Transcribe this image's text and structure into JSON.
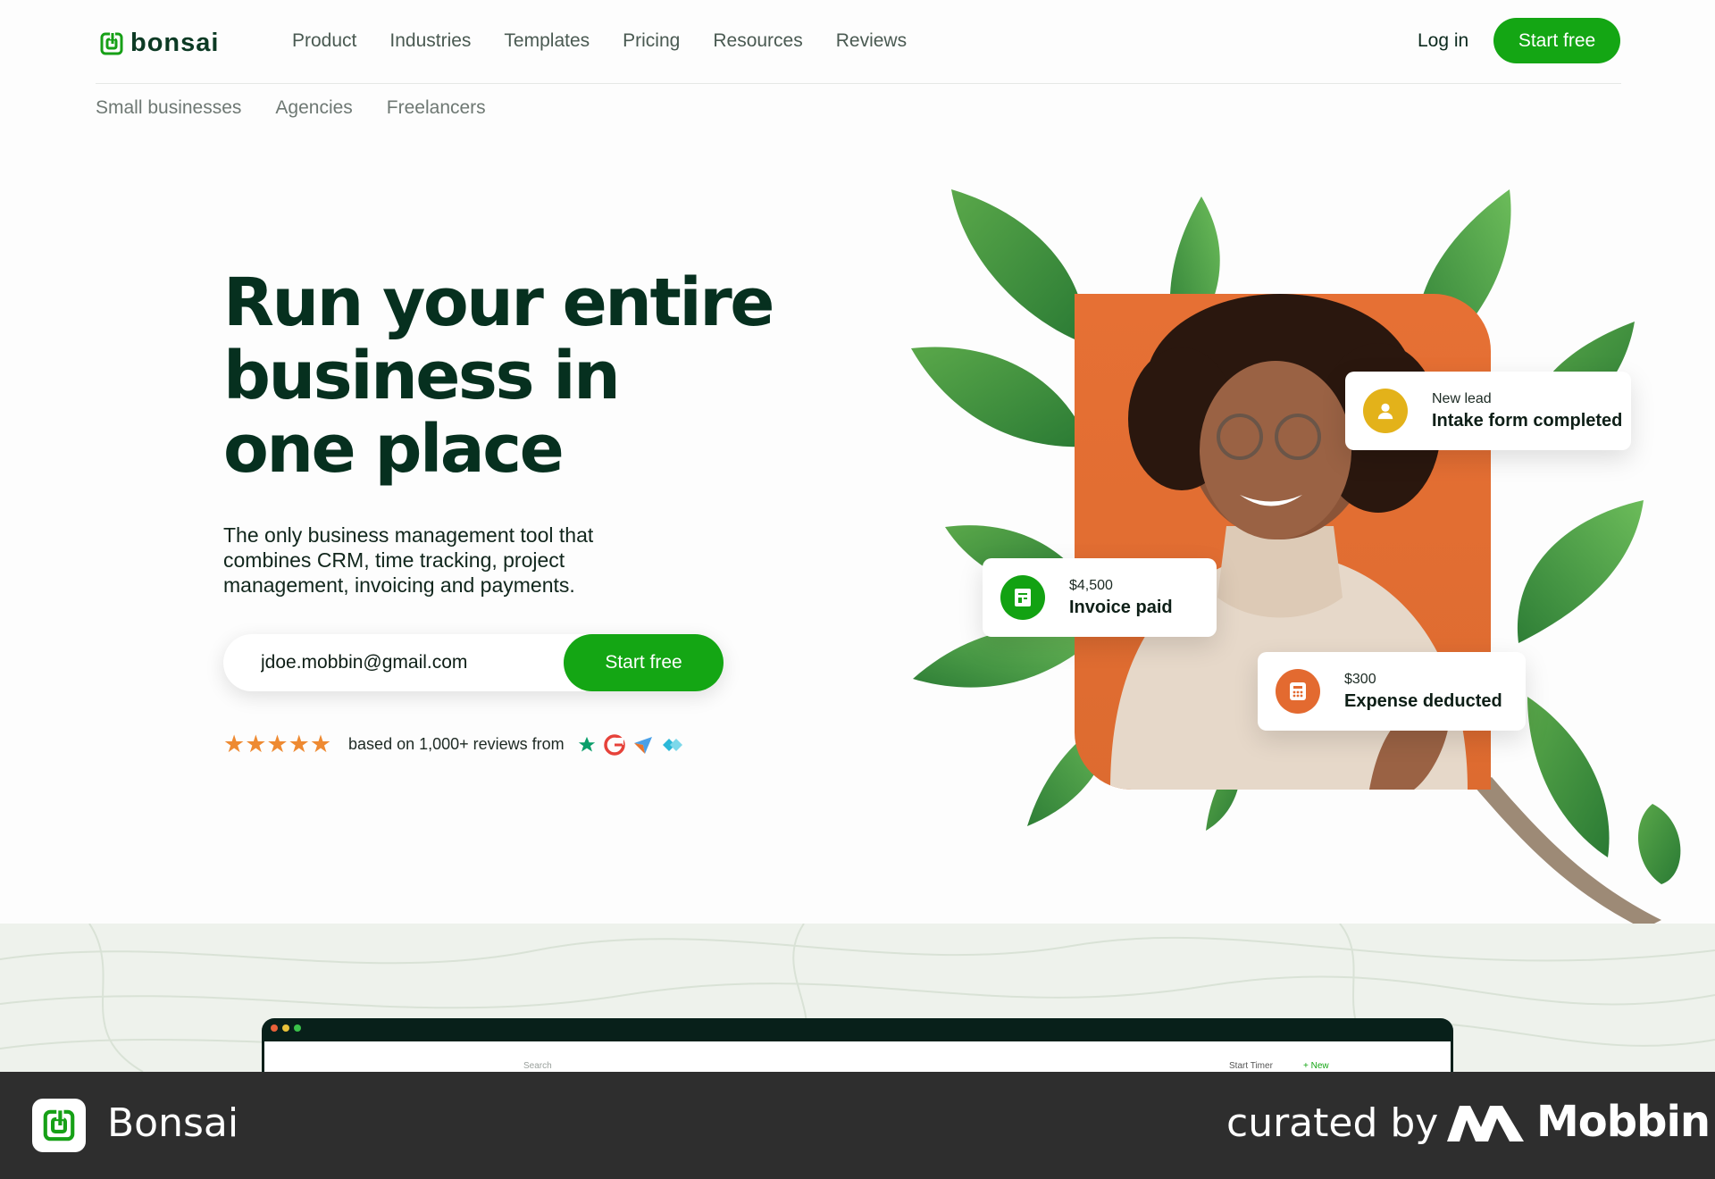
{
  "app": {
    "brand": "bonsai",
    "accent": "#14a614"
  },
  "nav": {
    "menu": [
      "Product",
      "Industries",
      "Templates",
      "Pricing",
      "Resources",
      "Reviews"
    ],
    "login": "Log in",
    "cta": "Start free",
    "subnav": [
      "Small businesses",
      "Agencies",
      "Freelancers"
    ]
  },
  "hero": {
    "headline_lines": [
      "Run your entire",
      "business in",
      "one place"
    ],
    "subtitle": "The only business management tool that combines CRM, time tracking, project management, invoicing and payments.",
    "email_value": "jdoe.mobbin@gmail.com",
    "cta": "Start free",
    "stars": "★★★★★",
    "reviews_text": "based on 1,000+ reviews from"
  },
  "cards": {
    "lead": {
      "small": "New lead",
      "big": "Intake form completed",
      "icon": "user-icon",
      "color": "#e3b21a"
    },
    "invoice": {
      "small": "$4,500",
      "big": "Invoice paid",
      "icon": "invoice-icon",
      "color": "#12a212"
    },
    "expense": {
      "small": "$300",
      "big": "Expense deducted",
      "icon": "calculator-icon",
      "color": "#e36a30"
    }
  },
  "preview": {
    "search": "Search",
    "timer": "Start Timer",
    "new": "+ New"
  },
  "footer": {
    "app_name": "Bonsai",
    "curated": "curated by",
    "brand": "Mobbin"
  }
}
